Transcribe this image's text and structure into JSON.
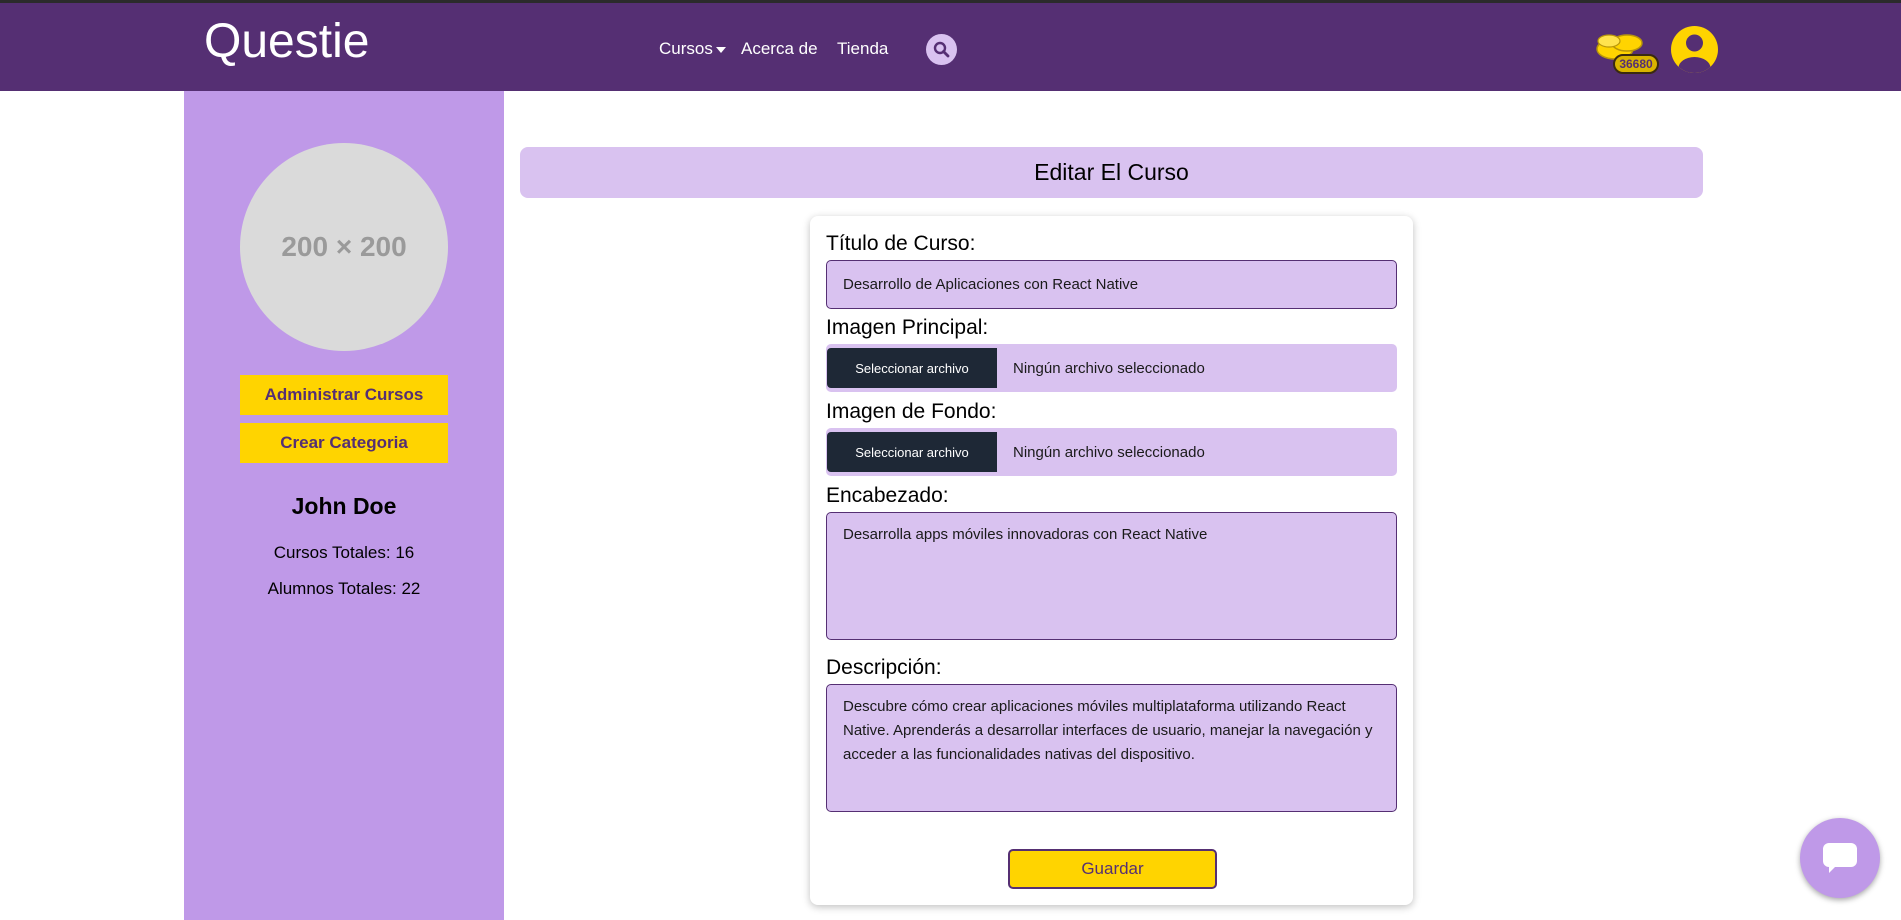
{
  "header": {
    "logo": "Questie",
    "nav": {
      "cursos": "Cursos",
      "acerca": "Acerca de",
      "tienda": "Tienda"
    },
    "coin_count": "36680",
    "icons": {
      "search": "search-icon",
      "coins": "coins-icon",
      "user": "user-icon",
      "caret": "caret-down-icon"
    }
  },
  "sidebar": {
    "profile_placeholder": "200 × 200",
    "buttons": {
      "admin": "Administrar Cursos",
      "category": "Crear Categoria"
    },
    "user_name": "John Doe",
    "stats": {
      "cursos": "Cursos Totales: 16",
      "alumnos": "Alumnos Totales: 22"
    }
  },
  "main": {
    "title": "Editar El Curso",
    "form": {
      "titulo_label": "Título de Curso:",
      "titulo_value": "Desarrollo de Aplicaciones con React Native",
      "imagen_principal_label": "Imagen Principal:",
      "imagen_fondo_label": "Imagen de Fondo:",
      "file_button": "Seleccionar archivo",
      "file_status": "Ningún archivo seleccionado",
      "encabezado_label": "Encabezado:",
      "encabezado_value": "Desarrolla apps móviles innovadoras con React Native",
      "descripcion_label": "Descripción:",
      "descripcion_value": "Descubre cómo crear aplicaciones móviles multiplataforma utilizando React Native. Aprenderás a desarrollar interfaces de usuario, manejar la navegación y acceder a las funcionalidades nativas del dispositivo.",
      "save": "Guardar"
    }
  },
  "chat": {
    "icon": "chat-icon"
  },
  "colors": {
    "brand": "#552f73",
    "sidebar": "#bf99e8",
    "field": "#d9c2f0",
    "accent": "#ffd400",
    "file_button": "#1e2836"
  }
}
